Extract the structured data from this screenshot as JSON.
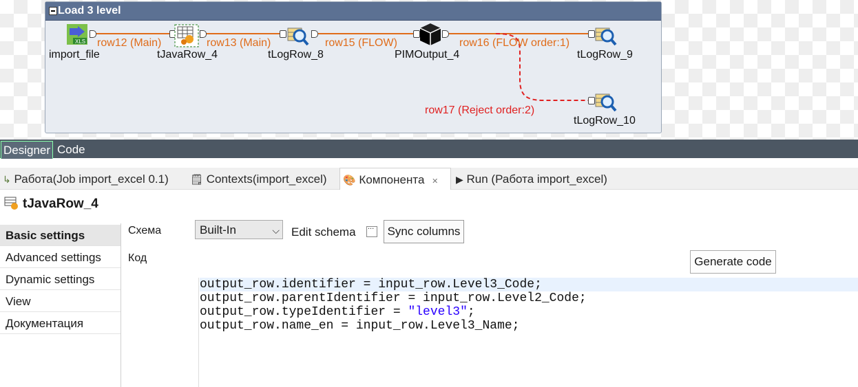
{
  "canvas": {
    "subjob_title": "Load 3 level",
    "components": {
      "import_file": "import_file",
      "tjavarow": "tJavaRow_4",
      "tlogrow8": "tLogRow_8",
      "pimoutput": "PIMOutput_4",
      "tlogrow9": "tLogRow_9",
      "tlogrow10": "tLogRow_10"
    },
    "links": {
      "row12": "row12 (Main)",
      "row13": "row13 (Main)",
      "row15": "row15 (FLOW)",
      "row16": "row16 (FLOW order:1)",
      "row17": "row17 (Reject order:2)"
    },
    "icons": {
      "import_file": "xls-file-input-icon",
      "tjavarow": "java-row-icon",
      "tlogrow": "log-row-magnifier-icon",
      "pimoutput": "black-cube-icon"
    },
    "colors": {
      "flow": "#e06c1a",
      "reject": "#e02020",
      "subjob_header": "#5c7193"
    }
  },
  "editor_tabs": {
    "designer": "Designer",
    "code": "Code"
  },
  "view_tabs": {
    "job": "Работа(Job import_excel 0.1)",
    "contexts": "Contexts(import_excel)",
    "component": "Компонента",
    "run": "Run (Работа import_excel)"
  },
  "component_title": "tJavaRow_4",
  "sidebar": {
    "items": [
      {
        "label": "Basic settings"
      },
      {
        "label": "Advanced settings"
      },
      {
        "label": "Dynamic settings"
      },
      {
        "label": "View"
      },
      {
        "label": "Документация"
      }
    ]
  },
  "form": {
    "schema_label": "Схема",
    "schema_value": "Built-In",
    "edit_schema": "Edit schema",
    "edit_schema_button": "...",
    "sync_columns": "Sync columns",
    "code_label": "Код",
    "generate_code": "Generate code"
  },
  "code": {
    "line1": "output_row.identifier = input_row.Level3_Code;",
    "line2": "output_row.parentIdentifier = input_row.Level2_Code;",
    "line3_pre": "output_row.typeIdentifier = ",
    "line3_str": "\"level3\"",
    "line3_post": ";",
    "line4": "output_row.name_en = input_row.Level3_Name;"
  }
}
